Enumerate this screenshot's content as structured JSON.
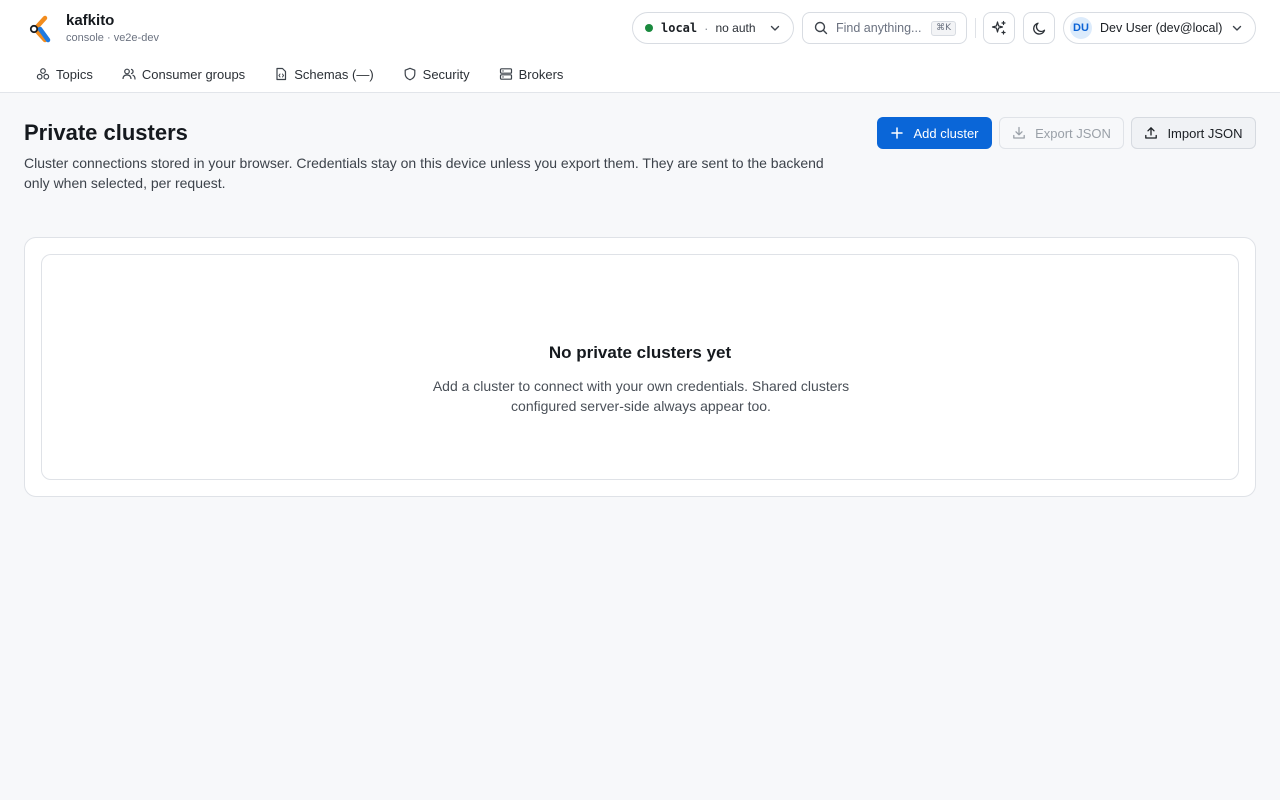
{
  "brand": {
    "name": "kafkito",
    "subtitle": "console · ve2e-dev"
  },
  "cluster_selector": {
    "status_color": "#1a8a3e",
    "name": "local",
    "separator": "·",
    "auth": "no auth"
  },
  "search": {
    "placeholder": "Find anything...",
    "shortcut": "⌘K"
  },
  "user": {
    "initials": "DU",
    "label": "Dev User (dev@local)"
  },
  "nav": {
    "items": [
      {
        "label": "Topics",
        "icon": "topics-icon"
      },
      {
        "label": "Consumer groups",
        "icon": "users-icon"
      },
      {
        "label": "Schemas (—)",
        "icon": "schema-file-icon"
      },
      {
        "label": "Security",
        "icon": "shield-icon"
      },
      {
        "label": "Brokers",
        "icon": "server-icon"
      }
    ]
  },
  "page": {
    "title": "Private clusters",
    "description": "Cluster connections stored in your browser. Credentials stay on this device unless you export them. They are sent to the backend only when selected, per request."
  },
  "actions": {
    "add_cluster": "Add cluster",
    "export_json": "Export JSON",
    "import_json": "Import JSON"
  },
  "empty_state": {
    "title": "No private clusters yet",
    "text": "Add a cluster to connect with your own credentials. Shared clusters configured server-side always appear too."
  },
  "colors": {
    "accent": "#0a66d8",
    "background": "#f7f8fa"
  }
}
